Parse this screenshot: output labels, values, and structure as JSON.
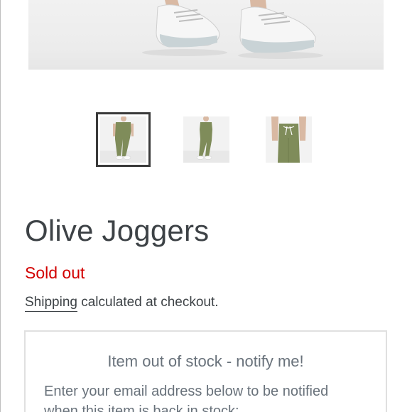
{
  "product": {
    "title": "Olive Joggers",
    "status": "Sold out",
    "shipping_link": "Shipping",
    "shipping_rest": " calculated at checkout."
  },
  "gallery": {
    "thumbnails": [
      {
        "label": "front view",
        "selected": true
      },
      {
        "label": "side view",
        "selected": false
      },
      {
        "label": "close-up view",
        "selected": false
      }
    ]
  },
  "notify": {
    "title": "Item out of stock - notify me!",
    "text": "Enter your email address below to be notified when this item is back in stock:"
  },
  "colors": {
    "sold_out": "#d20000",
    "title": "#3d4246",
    "muted": "#69727b",
    "olive": "#7f8c5a"
  }
}
